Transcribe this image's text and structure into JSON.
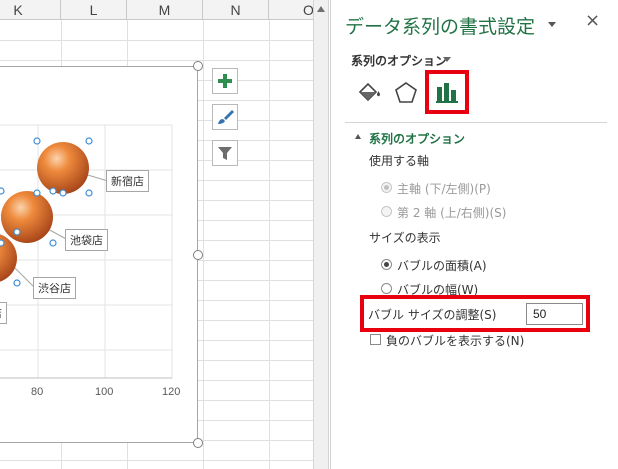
{
  "spreadsheet": {
    "columns": [
      "K",
      "L",
      "M",
      "N",
      "O"
    ]
  },
  "chart": {
    "data_labels": [
      "新宿店",
      "池袋店",
      "渋谷店",
      "店"
    ],
    "x_ticks": [
      "80",
      "100",
      "120"
    ],
    "bubble_color": "#e0772a"
  },
  "chart_tools": [
    {
      "icon": "plus-icon"
    },
    {
      "icon": "brush-icon"
    },
    {
      "icon": "filter-icon"
    }
  ],
  "pane": {
    "title": "データ系列の書式設定",
    "close": "×",
    "series_options_menu": "系列のオプション",
    "tabs": [
      {
        "icon": "paint-bucket-icon"
      },
      {
        "icon": "pentagon-icon"
      },
      {
        "icon": "bar-chart-icon",
        "selected": true
      }
    ],
    "section_title": "系列のオプション",
    "axis_heading": "使用する軸",
    "axis_options": [
      {
        "label": "主軸 (下/左側)(P)",
        "checked": true,
        "enabled": false
      },
      {
        "label": "第 2 軸 (上/右側)(S)",
        "checked": false,
        "enabled": false
      }
    ],
    "size_heading": "サイズの表示",
    "size_options": [
      {
        "label": "バブルの面積(A)",
        "checked": true
      },
      {
        "label": "バブルの幅(W)",
        "checked": false
      }
    ],
    "scale_label": "バブル サイズの調整(S)",
    "scale_value": "50",
    "negative_label": "負のバブルを表示する(N)",
    "negative_checked": false
  },
  "colors": {
    "accent": "#217346",
    "highlight": "#e8000e"
  }
}
